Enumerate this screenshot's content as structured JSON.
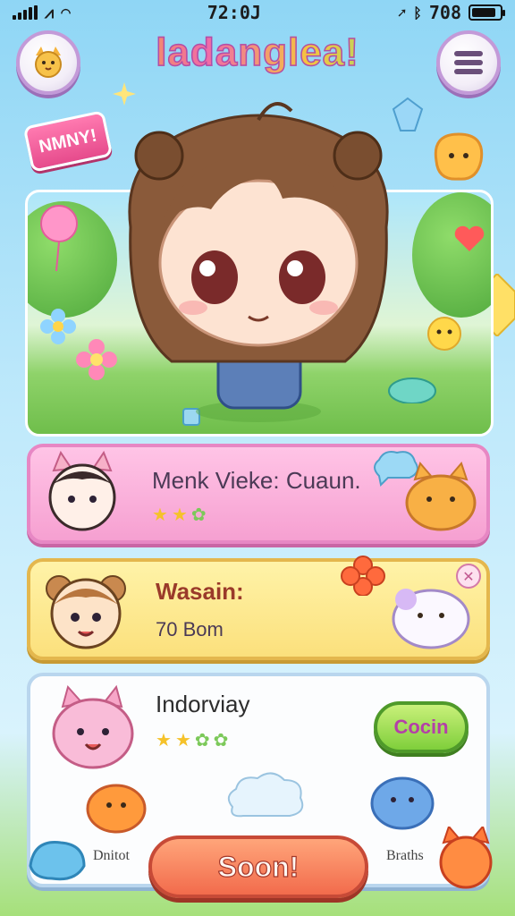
{
  "status_bar": {
    "time": "72:0J",
    "battery": "708",
    "battery_level": 0.85
  },
  "header": {
    "title": "ladanglea!"
  },
  "badge": {
    "label": "NMNY!"
  },
  "cards": [
    {
      "title": "Menk Vieke: Cuaun.",
      "stars": [
        "★",
        "★",
        "✿"
      ]
    },
    {
      "title": "Wasain:",
      "subtitle": "70 Bom"
    },
    {
      "title": "Indorviay",
      "stars": [
        "★",
        "★",
        "✿",
        "✿"
      ]
    }
  ],
  "buttons": {
    "coin": "Cocin",
    "start": "Soon!"
  },
  "bottom_labels": {
    "left": "Dnitot",
    "right": "Braths"
  },
  "colors": {
    "pink_card": "#f6a0d1",
    "yellow_card": "#fbe07c",
    "start_button": "#f26b4c"
  }
}
